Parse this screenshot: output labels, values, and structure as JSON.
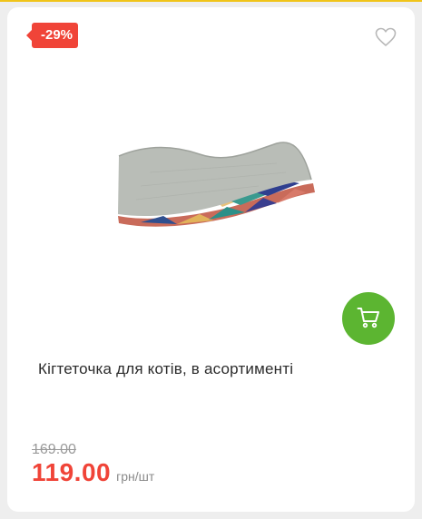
{
  "badge": {
    "discount": "-29%"
  },
  "icons": {
    "favorite": "heart-outline-icon",
    "cart": "cart-icon"
  },
  "product": {
    "title": "Кігтеточка для котів, в асортименті",
    "old_price": "169.00",
    "price": "119.00",
    "unit": "грн/шт"
  },
  "colors": {
    "accent_red": "#f04438",
    "cart_green": "#5cb531",
    "top_strip": "#f0c419"
  }
}
